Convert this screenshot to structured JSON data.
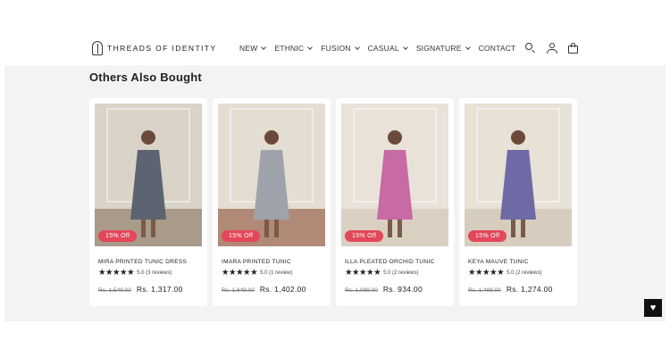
{
  "header": {
    "brand": "THREADS OF IDENTITY",
    "nav": [
      {
        "label": "NEW",
        "dropdown": true
      },
      {
        "label": "ETHNIC",
        "dropdown": true
      },
      {
        "label": "FUSION",
        "dropdown": true
      },
      {
        "label": "CASUAL",
        "dropdown": true
      },
      {
        "label": "SIGNATURE",
        "dropdown": true
      },
      {
        "label": "CONTACT",
        "dropdown": false
      }
    ],
    "icons": [
      "search-icon",
      "account-icon",
      "cart-icon"
    ]
  },
  "section": {
    "title": "Others Also Bought"
  },
  "products": [
    {
      "badge": "15% Off",
      "name": "MIRA PRINTED TUNIC DRESS",
      "stars": "★★★★★",
      "rating": "5.0 (3 reviews)",
      "old_price": "Rs. 1,549.00",
      "price": "Rs. 1,317.00",
      "wall": "#d9d3c8",
      "floor": "#a99a8a",
      "outfit": "#5b6470"
    },
    {
      "badge": "15% Off",
      "name": "IMARA PRINTED TUNIC",
      "stars": "★★★★★",
      "rating": "5.0 (1 review)",
      "old_price": "Rs. 1,649.00",
      "price": "Rs. 1,402.00",
      "wall": "#e4ddd2",
      "floor": "#b08a76",
      "outfit": "#9ea3ab"
    },
    {
      "badge": "15% Off",
      "name": "ILLA PLEATED ORCHID TUNIC",
      "stars": "★★★★★",
      "rating": "5.0 (2 reviews)",
      "old_price": "Rs. 1,099.00",
      "price": "Rs. 934.00",
      "wall": "#e8e2d8",
      "floor": "#d9d0c2",
      "outfit": "#c86aa4"
    },
    {
      "badge": "15% Off",
      "name": "KEYA MAUVE TUNIC",
      "stars": "★★★★★",
      "rating": "5.0 (2 reviews)",
      "old_price": "Rs. 1,499.00",
      "price": "Rs. 1,274.00",
      "wall": "#e7e1d6",
      "floor": "#d6cdbf",
      "outfit": "#6f6aa6"
    }
  ],
  "wishlist": {
    "icon": "heart-icon",
    "glyph": "♥"
  }
}
